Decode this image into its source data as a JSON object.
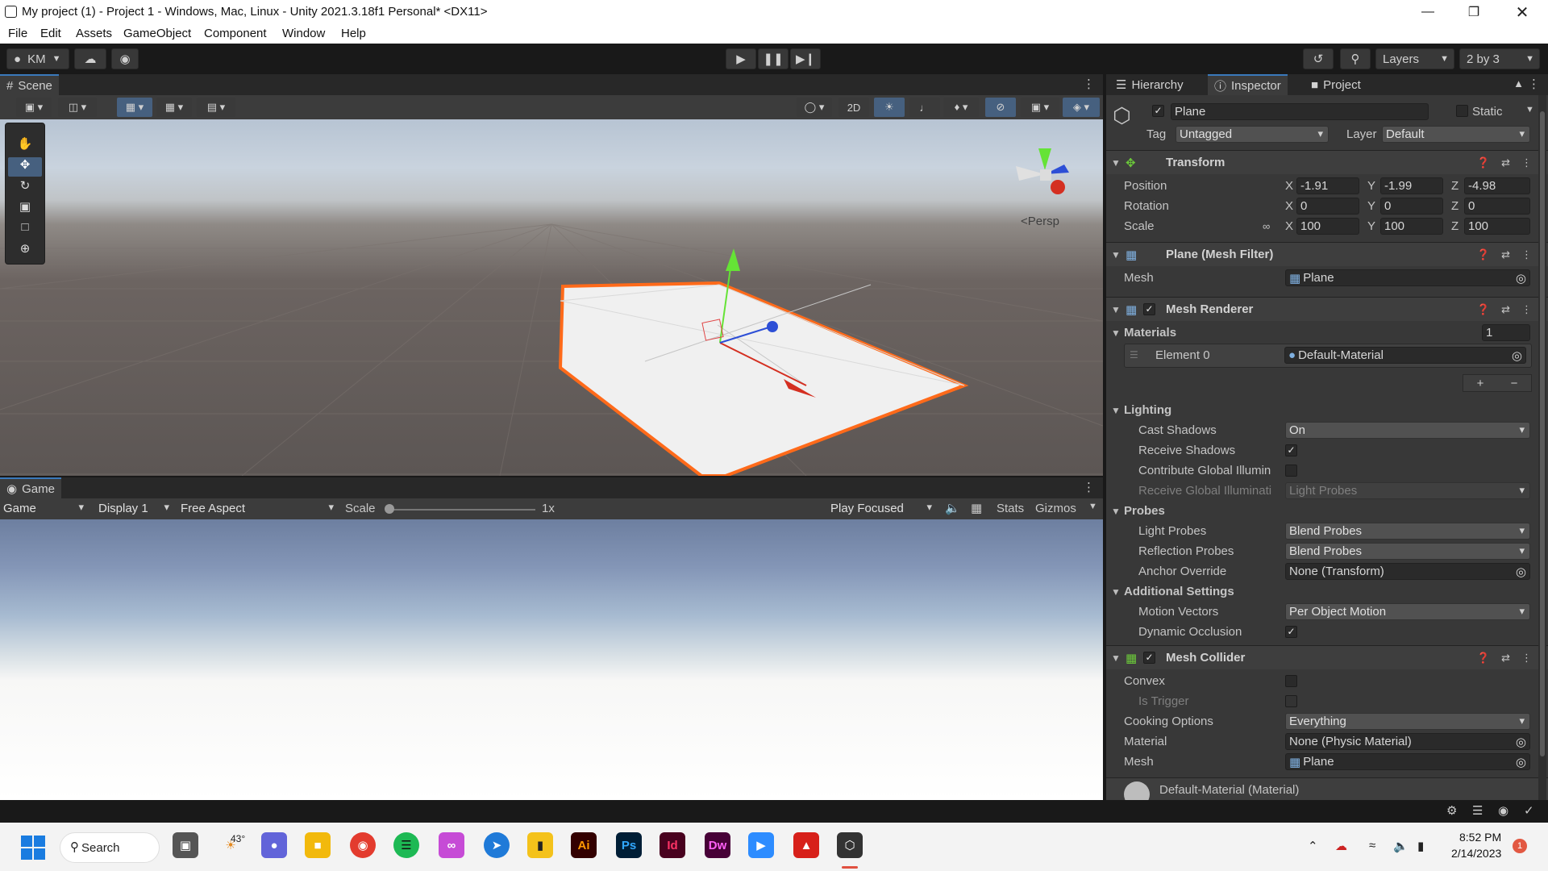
{
  "window": {
    "title": "My project (1) - Project 1 - Windows, Mac, Linux - Unity 2021.3.18f1 Personal* <DX11>"
  },
  "menu": [
    "File",
    "Edit",
    "Assets",
    "GameObject",
    "Component",
    "Window",
    "Help"
  ],
  "toolbar": {
    "account": "KM",
    "layers": "Layers",
    "layout": "2 by 3"
  },
  "scene": {
    "tab": "Scene",
    "mode_2d": "2D",
    "persp": "<Persp"
  },
  "game": {
    "tab": "Game",
    "view": "Game",
    "display": "Display 1",
    "aspect": "Free Aspect",
    "scale_label": "Scale",
    "scale_value": "1x",
    "play_mode": "Play Focused",
    "stats": "Stats",
    "gizmos": "Gizmos"
  },
  "tabs": {
    "hierarchy": "Hierarchy",
    "inspector": "Inspector",
    "project": "Project"
  },
  "object": {
    "name": "Plane",
    "static": "Static",
    "tag_label": "Tag",
    "tag": "Untagged",
    "layer_label": "Layer",
    "layer": "Default"
  },
  "transform": {
    "title": "Transform",
    "position_label": "Position",
    "rotation_label": "Rotation",
    "scale_label": "Scale",
    "position": {
      "x": "-1.91",
      "y": "-1.99",
      "z": "-4.98"
    },
    "rotation": {
      "x": "0",
      "y": "0",
      "z": "0"
    },
    "scale": {
      "x": "100",
      "y": "100",
      "z": "100"
    }
  },
  "mesh_filter": {
    "title": "Plane (Mesh Filter)",
    "mesh_label": "Mesh",
    "mesh": "Plane"
  },
  "mesh_renderer": {
    "title": "Mesh Renderer",
    "materials_label": "Materials",
    "materials_count": "1",
    "element0_label": "Element 0",
    "element0": "Default-Material",
    "lighting": "Lighting",
    "cast_shadows_label": "Cast Shadows",
    "cast_shadows": "On",
    "receive_shadows_label": "Receive Shadows",
    "contribute_gi_label": "Contribute Global Illumin",
    "receive_gi_label": "Receive Global Illuminati",
    "receive_gi": "Light Probes",
    "probes": "Probes",
    "light_probes_label": "Light Probes",
    "light_probes": "Blend Probes",
    "reflection_probes_label": "Reflection Probes",
    "reflection_probes": "Blend Probes",
    "anchor_override_label": "Anchor Override",
    "anchor_override": "None (Transform)",
    "additional": "Additional Settings",
    "motion_vectors_label": "Motion Vectors",
    "motion_vectors": "Per Object Motion",
    "dynamic_occlusion_label": "Dynamic Occlusion"
  },
  "mesh_collider": {
    "title": "Mesh Collider",
    "convex_label": "Convex",
    "is_trigger_label": "Is Trigger",
    "cooking_label": "Cooking Options",
    "cooking": "Everything",
    "material_label": "Material",
    "material": "None (Physic Material)",
    "mesh_label": "Mesh",
    "mesh": "Plane"
  },
  "material_footer": "Default-Material (Material)",
  "taskbar": {
    "search": "Search",
    "weather": "43°",
    "time": "8:52 PM",
    "date": "2/14/2023",
    "notifications": "1",
    "apps": [
      "Ai",
      "Ps",
      "Id",
      "Dw"
    ]
  },
  "colors": {
    "accent": "#3a79bb",
    "selection_outline": "#ff6a1a",
    "gizmo_x": "#d42f21",
    "gizmo_y": "#65e336",
    "gizmo_z": "#2d4fd6"
  }
}
